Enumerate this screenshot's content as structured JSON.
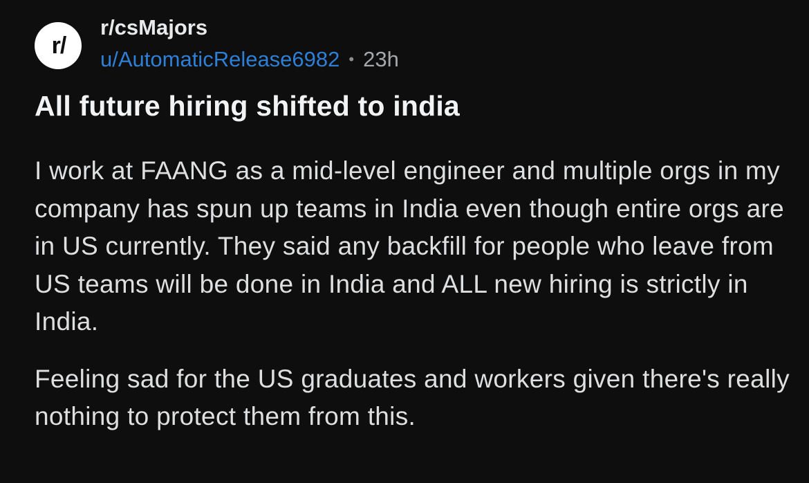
{
  "post": {
    "avatar_text": "r/",
    "subreddit": "r/csMajors",
    "author": "u/AutomaticRelease6982",
    "separator": "•",
    "age": "23h",
    "title": "All future hiring shifted to india",
    "paragraphs": [
      "I work at FAANG as a mid-level engineer and multiple orgs in my company has spun up teams in India even though entire orgs are in US currently. They said any backfill for people who leave from US teams will be done in India and ALL new hiring is strictly in India.",
      "Feeling sad for the US graduates and workers given there's really nothing to protect them from this."
    ]
  },
  "colors": {
    "background": "#0e0e0e",
    "text": "#dedfe0",
    "username": "#2e7fd6",
    "avatar_bg": "#ffffff"
  },
  "icons": {
    "avatar": "subreddit-avatar-icon"
  }
}
